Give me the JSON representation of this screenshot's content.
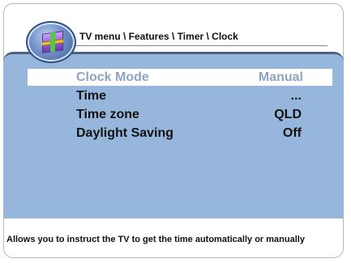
{
  "header": {
    "breadcrumb": "TV menu \\ Features \\ Timer \\ Clock"
  },
  "logo": {
    "icon": "tv-menu-box-icon"
  },
  "menu": {
    "items": [
      {
        "label": "Clock Mode",
        "value": "Manual",
        "selected": true
      },
      {
        "label": "Time",
        "value": "..."
      },
      {
        "label": "Time zone",
        "value": "QLD"
      },
      {
        "label": "Daylight Saving",
        "value": "Off"
      }
    ]
  },
  "help": {
    "text": "Allows you to instruct the TV to  get the time automatically or manually"
  },
  "colors": {
    "panel": "#96b6dc",
    "panel_border": "#4a6180",
    "selected_text": "#8ea4c4"
  }
}
